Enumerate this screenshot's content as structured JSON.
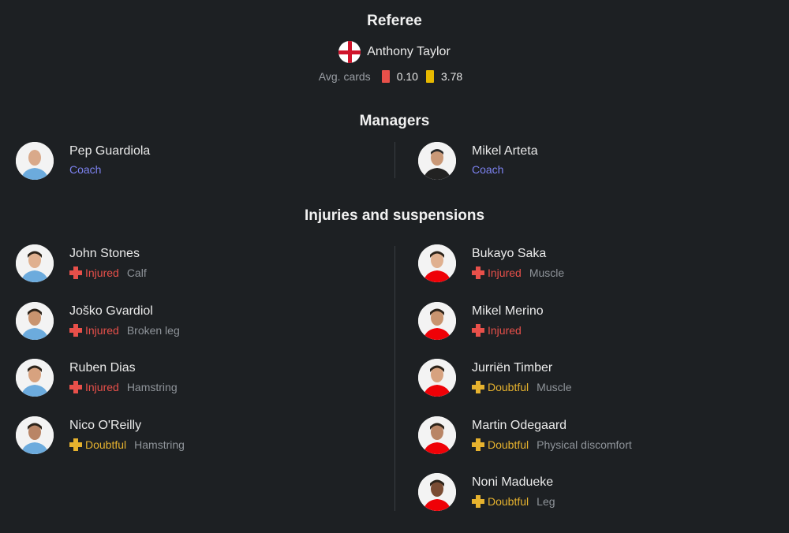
{
  "referee": {
    "title": "Referee",
    "name": "Anthony Taylor",
    "flag_icon": "england-flag-icon",
    "avg_cards_label": "Avg. cards",
    "red_avg": "0.10",
    "yellow_avg": "3.78",
    "red_color": "#e8504a",
    "yellow_color": "#e6b800"
  },
  "managers": {
    "title": "Managers",
    "home": {
      "name": "Pep Guardiola",
      "role": "Coach"
    },
    "away": {
      "name": "Mikel Arteta",
      "role": "Coach"
    }
  },
  "injuries": {
    "title": "Injuries and suspensions",
    "home": [
      {
        "name": "John Stones",
        "status": "Injured",
        "reason": "Calf"
      },
      {
        "name": "Joško Gvardiol",
        "status": "Injured",
        "reason": "Broken leg"
      },
      {
        "name": "Ruben Dias",
        "status": "Injured",
        "reason": "Hamstring"
      },
      {
        "name": "Nico O'Reilly",
        "status": "Doubtful",
        "reason": "Hamstring"
      }
    ],
    "away": [
      {
        "name": "Bukayo Saka",
        "status": "Injured",
        "reason": "Muscle"
      },
      {
        "name": "Mikel Merino",
        "status": "Injured",
        "reason": ""
      },
      {
        "name": "Jurriën Timber",
        "status": "Doubtful",
        "reason": "Muscle"
      },
      {
        "name": "Martin Odegaard",
        "status": "Doubtful",
        "reason": "Physical discomfort"
      },
      {
        "name": "Noni Madueke",
        "status": "Doubtful",
        "reason": "Leg"
      }
    ]
  },
  "colors": {
    "background": "#1d2023",
    "coach_role": "#7d82f0",
    "injured": "#e8504a",
    "doubtful": "#e6b22e",
    "home_kit": "#6cabdd",
    "away_kit": "#ef0107"
  }
}
